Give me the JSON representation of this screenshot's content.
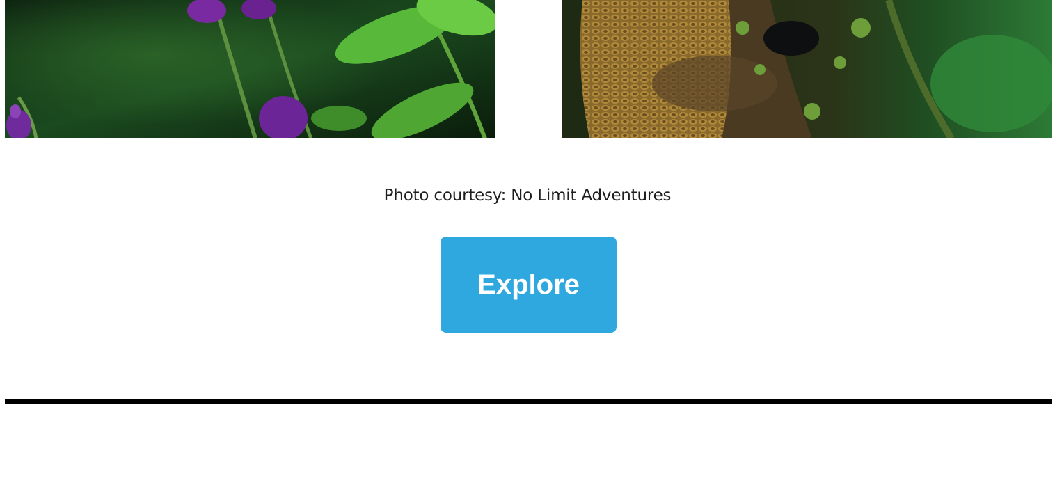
{
  "images": {
    "left": {
      "subject": "purple-verbena-flowers"
    },
    "right": {
      "subject": "coiled-snake-on-mossy-branch"
    }
  },
  "caption": {
    "text": "Photo courtesy: No Limit Adventures"
  },
  "cta": {
    "label": "Explore",
    "color": "#2ea8de"
  },
  "divider": {
    "color": "#000000"
  }
}
